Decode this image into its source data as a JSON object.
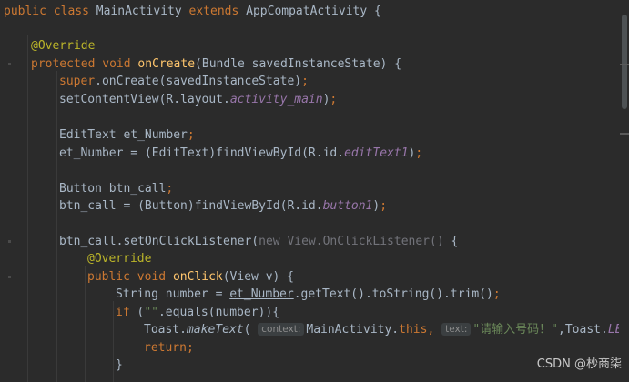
{
  "code": {
    "l1": {
      "kw1": "public",
      "kw2": "class",
      "name": "MainActivity",
      "kw3": "extends",
      "parent": "AppCompatActivity {"
    },
    "l2": {
      "ann": "@Override"
    },
    "l3": {
      "kw1": "protected",
      "kw2": "void",
      "fn": "onCreate",
      "rest": "(Bundle savedInstanceState) {"
    },
    "l4": {
      "kw": "super",
      "rest": ".onCreate(savedInstanceState)",
      "semi": ";"
    },
    "l5": {
      "pre": "setContentView(R.layout.",
      "field": "activity_main",
      "post": ")",
      "semi": ";"
    },
    "l6": {
      "text": "EditText et_Number",
      "semi": ";"
    },
    "l7": {
      "pre": "et_Number = (EditText)findViewById(R.id.",
      "field": "editText1",
      "post": ")",
      "semi": ";"
    },
    "l8": {
      "text": "Button btn_call",
      "semi": ";"
    },
    "l9": {
      "pre": "btn_call = (Button)findViewById(R.id.",
      "field": "button1",
      "post": ")",
      "semi": ";"
    },
    "l10": {
      "pre": "btn_call.setOnClickListener(",
      "dim": "new View.OnClickListener()",
      "post": " {"
    },
    "l11": {
      "ann": "@Override"
    },
    "l12": {
      "kw1": "public",
      "kw2": "void",
      "fn": "onClick",
      "rest": "(View v) {"
    },
    "l13": {
      "pre": "String number = ",
      "under": "et_Number",
      "post": ".getText().toString().trim()",
      "semi": ";"
    },
    "l14": {
      "kw": "if",
      "pre": " (",
      "str": "\"\"",
      "post": ".equals(number)){"
    },
    "l15": {
      "pre": "Toast.",
      "mth": "makeText",
      "paren": "(",
      "hint1": "context:",
      "arg1": "MainActivity.",
      "kw": "this",
      "comma1": ",",
      "hint2": "text:",
      "str": "\"请输入号码！\"",
      "comma2": ",Toast.",
      "field": "LENGTH"
    },
    "l16": {
      "kw": "return",
      "semi": ";"
    },
    "l17": {
      "text": "}"
    }
  },
  "watermark": "CSDN @杪商柒"
}
